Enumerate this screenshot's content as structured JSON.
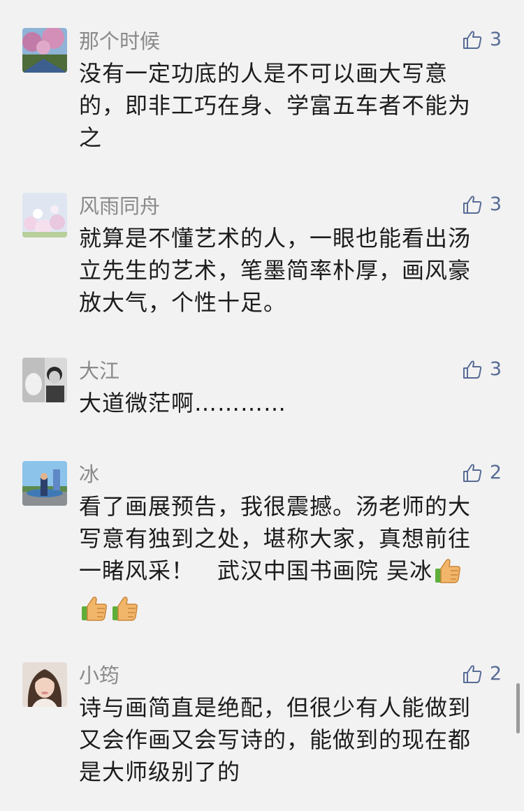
{
  "comments": [
    {
      "name": "那个时候",
      "likes": "3",
      "text": "没有一定功底的人是不可以画大写意的，即非工巧在身、学富五车者不能为之"
    },
    {
      "name": "风雨同舟",
      "likes": "3",
      "text": "就算是不懂艺术的人，一眼也能看出汤立先生的艺术，笔墨简率朴厚，画风豪放大气，个性十足。"
    },
    {
      "name": "大江",
      "likes": "3",
      "text": "大道微茫啊…………"
    },
    {
      "name": "冰",
      "likes": "2",
      "text": "看了画展预告，我很震撼。汤老师的大写意有独到之处，堪称大家，真想前往一睹风采！　武汉中国书画院  吴冰"
    },
    {
      "name": "小筠",
      "likes": "2",
      "text": "诗与画简直是绝配，但很少有人能做到又会作画又会写诗的，能做到的现在都是大师级别了的"
    }
  ],
  "icons": {
    "like": "thumbs-up-outline-icon",
    "emoji": "thumbs-up-emoji"
  },
  "colors": {
    "background": "#f2f2f2",
    "name": "#8a8a8a",
    "text": "#1c1c1c",
    "like": "#576b95"
  }
}
